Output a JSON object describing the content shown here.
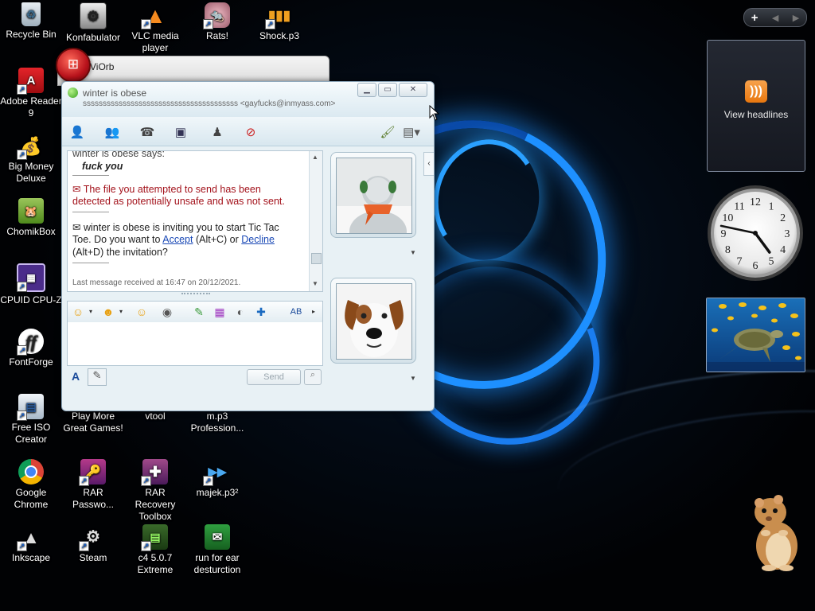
{
  "desktop": {
    "icons": [
      {
        "label": "Recycle Bin",
        "icon": "recycle-bin-icon"
      },
      {
        "label": "Konfabulator",
        "icon": "konfabulator-icon"
      },
      {
        "label": "VLC media player",
        "icon": "vlc-icon"
      },
      {
        "label": "Rats!",
        "icon": "rats-icon"
      },
      {
        "label": "Shock.p3",
        "icon": "shock-icon"
      },
      {
        "label": "Adobe Reader 9",
        "icon": "adobe-reader-icon"
      },
      {
        "label": "Big Money Deluxe",
        "icon": "big-money-icon"
      },
      {
        "label": "ChomikBox",
        "icon": "chomikbox-icon"
      },
      {
        "label": "CPUID CPU-Z",
        "icon": "cpuz-icon"
      },
      {
        "label": "FontForge",
        "icon": "fontforge-icon"
      },
      {
        "label": "Free ISO Creator",
        "icon": "iso-creator-icon"
      },
      {
        "label": "Play More Great Games!",
        "icon": "games-icon"
      },
      {
        "label": "vtool",
        "icon": "vtool-icon"
      },
      {
        "label": "m.p3 Profession...",
        "icon": "mp3-icon"
      },
      {
        "label": "Google Chrome",
        "icon": "chrome-icon"
      },
      {
        "label": "RAR Passwo...",
        "icon": "rar-password-icon"
      },
      {
        "label": "RAR Recovery Toolbox",
        "icon": "rar-recovery-icon"
      },
      {
        "label": "majek.p3²",
        "icon": "majek-icon"
      },
      {
        "label": "Inkscape",
        "icon": "inkscape-icon"
      },
      {
        "label": "Steam",
        "icon": "steam-icon"
      },
      {
        "label": "c4 5.0.7 Extreme",
        "icon": "c4-icon"
      },
      {
        "label": "run for ear desturction",
        "icon": "run-for-ear-icon"
      }
    ]
  },
  "gadgets": {
    "control_add": "+",
    "feed_label": "View headlines",
    "clock": {
      "hour": 4,
      "minute": 47
    }
  },
  "viorb": {
    "title": "ViOrb"
  },
  "messenger": {
    "contact_name": "winter is obese",
    "contact_sub": "sssssssssssssssssssssssssssssssssssssss <gayfucks@inmyass.com>",
    "conversation": {
      "says_line": "winter is obese says:",
      "message": "fuck you",
      "warning_line1": "The file you attempted to send has been",
      "warning_line2": "detected as potentially unsafe and was not sent.",
      "invite_line1": "winter is obese is inviting you to start Tic Tac",
      "invite_line2_pre": "Toe. Do you want to ",
      "accept": "Accept",
      "accept_key": " (Alt+C) or ",
      "decline": "Decline",
      "invite_line3": "(Alt+D) the invitation?",
      "last_message": "Last message received at 16:47 on 20/12/2021."
    },
    "send_label": "Send",
    "font_button": "A",
    "spell_button": "AB"
  }
}
